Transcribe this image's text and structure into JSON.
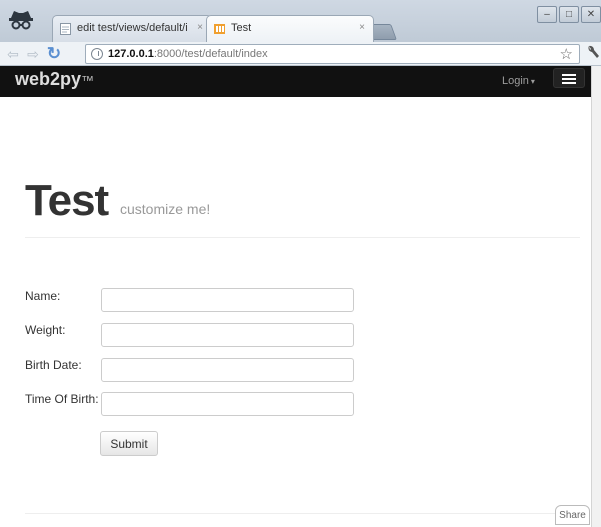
{
  "browser": {
    "tabs": [
      {
        "label": "edit test/views/default/index.html",
        "close": "×"
      },
      {
        "label": "Test",
        "close": "×"
      }
    ],
    "window_controls": [
      "–",
      "□",
      "✕"
    ],
    "nav": {
      "back": "⇦",
      "forward": "⇨",
      "reload": "↻"
    },
    "url": {
      "host": "127.0.0.1",
      "rest": ":8000/test/default/index"
    },
    "icons": {
      "star": "☆",
      "wrench": "🔧"
    }
  },
  "navbar": {
    "brand_prefix": "web",
    "brand_bold": "2py",
    "brand_tm": "™",
    "login_label": "Login",
    "login_caret": "▾"
  },
  "page": {
    "title": "Test",
    "subtitle": "customize me!"
  },
  "form": {
    "fields": [
      {
        "label": "Name:",
        "value": ""
      },
      {
        "label": "Weight:",
        "value": ""
      },
      {
        "label": "Birth Date:",
        "value": ""
      },
      {
        "label": "Time Of Birth:",
        "value": ""
      }
    ],
    "submit_label": "Submit"
  },
  "share_label": "Share",
  "colors": {
    "navbar_bg": "#111111",
    "title_text": "#333333",
    "subtitle_text": "#999999"
  }
}
